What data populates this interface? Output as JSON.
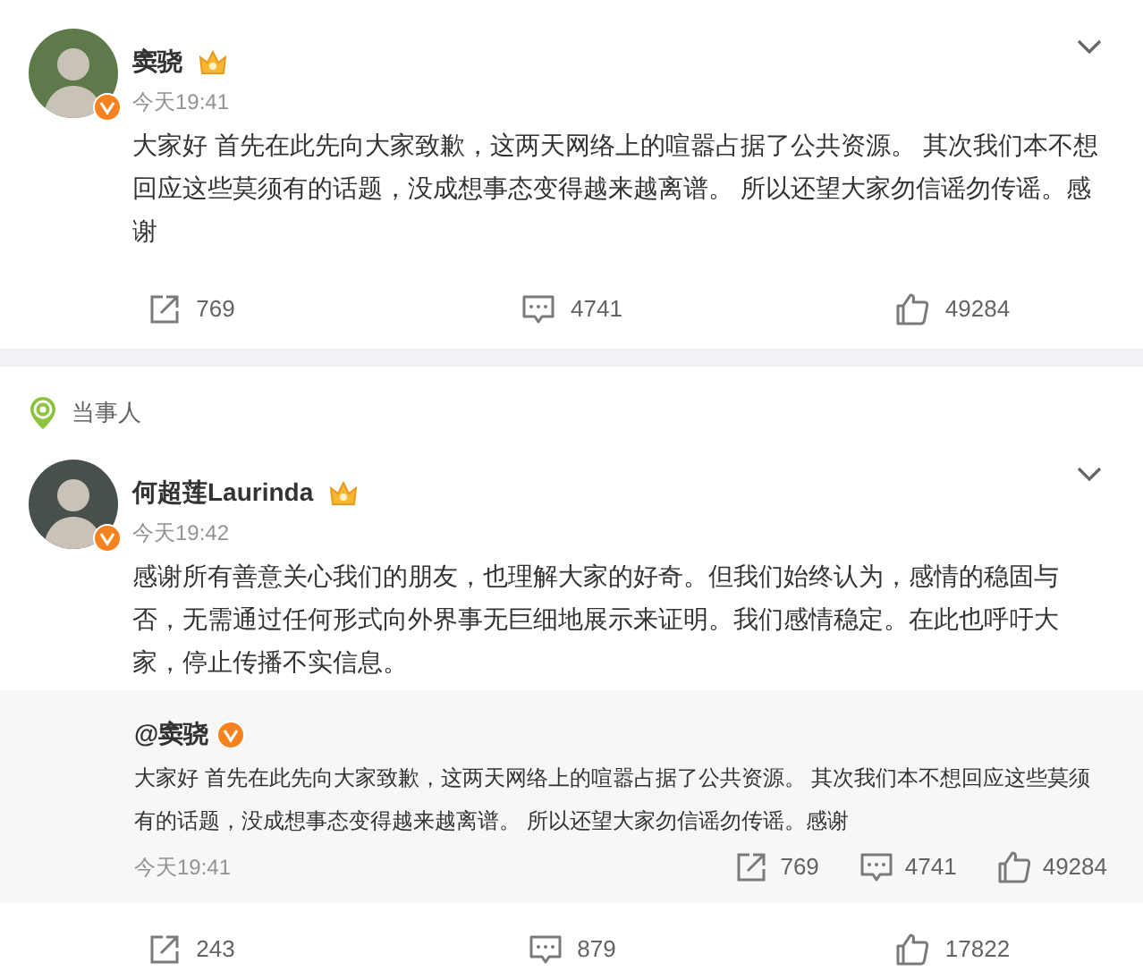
{
  "posts": [
    {
      "author": "窦骁",
      "time": "今天19:41",
      "text": "大家好 首先在此先向大家致歉，这两天网络上的喧嚣占据了公共资源。 其次我们本不想回应这些莫须有的话题，没成想事态变得越来越离谱。 所以还望大家勿信谣勿传谣。感谢",
      "actions": [
        {
          "kind": "repost",
          "count": "769"
        },
        {
          "kind": "comment",
          "count": "4741"
        },
        {
          "kind": "like",
          "count": "49284"
        }
      ]
    },
    {
      "section_label": "当事人",
      "author": "何超莲Laurinda",
      "time": "今天19:42",
      "text": "感谢所有善意关心我们的朋友，也理解大家的好奇。但我们始终认为，感情的稳固与否，无需通过任何形式向外界事无巨细地展示来证明。我们感情稳定。在此也呼吁大家，停止传播不实信息。",
      "quoted": {
        "author": "@窦骁",
        "text": "大家好 首先在此先向大家致歉，这两天网络上的喧嚣占据了公共资源。 其次我们本不想回应这些莫须有的话题，没成想事态变得越来越离谱。 所以还望大家勿信谣勿传谣。感谢",
        "time": "今天19:41",
        "actions": [
          {
            "kind": "repost",
            "count": "769"
          },
          {
            "kind": "comment",
            "count": "4741"
          },
          {
            "kind": "like",
            "count": "49284"
          }
        ]
      },
      "actions": [
        {
          "kind": "repost",
          "count": "243"
        },
        {
          "kind": "comment",
          "count": "879"
        },
        {
          "kind": "like",
          "count": "17822"
        }
      ]
    }
  ]
}
